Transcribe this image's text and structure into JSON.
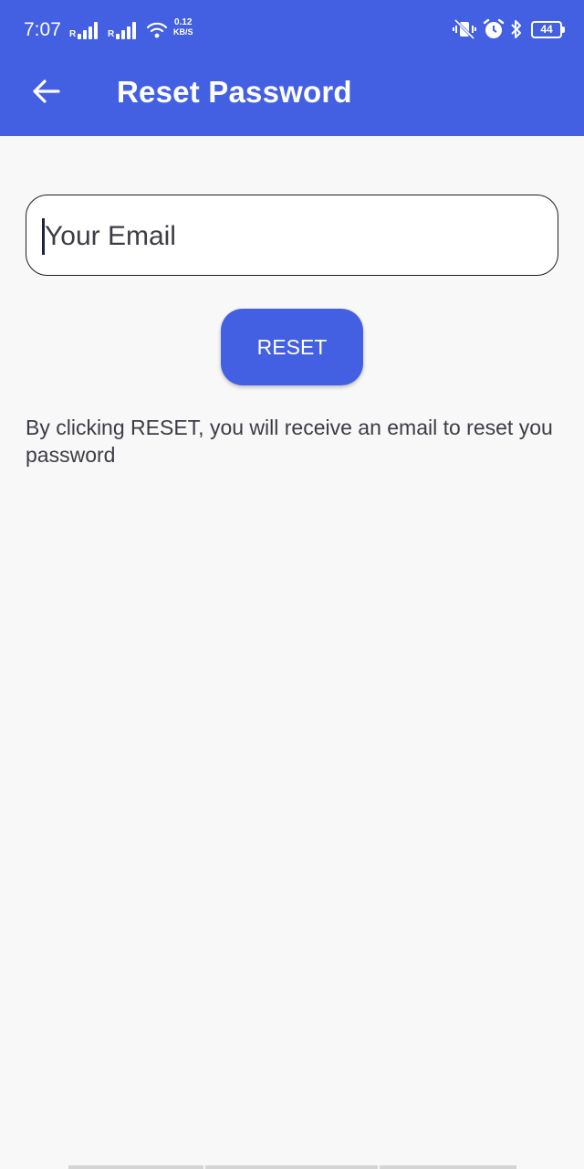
{
  "status_bar": {
    "time": "7:07",
    "signal_1_label": "R",
    "signal_2_label": "R",
    "net_speed_value": "0.12",
    "net_speed_unit": "KB/S",
    "battery_level": "44",
    "icons": [
      "vibrate-icon",
      "alarm-icon",
      "bluetooth-icon",
      "battery-icon"
    ]
  },
  "toolbar": {
    "title": "Reset Password",
    "back_icon": "arrow-left-icon",
    "color": "#4360e3"
  },
  "form": {
    "email_placeholder": "Your Email",
    "reset_label": "RESET",
    "info_text": "By clicking RESET, you will receive an email to reset you password"
  }
}
